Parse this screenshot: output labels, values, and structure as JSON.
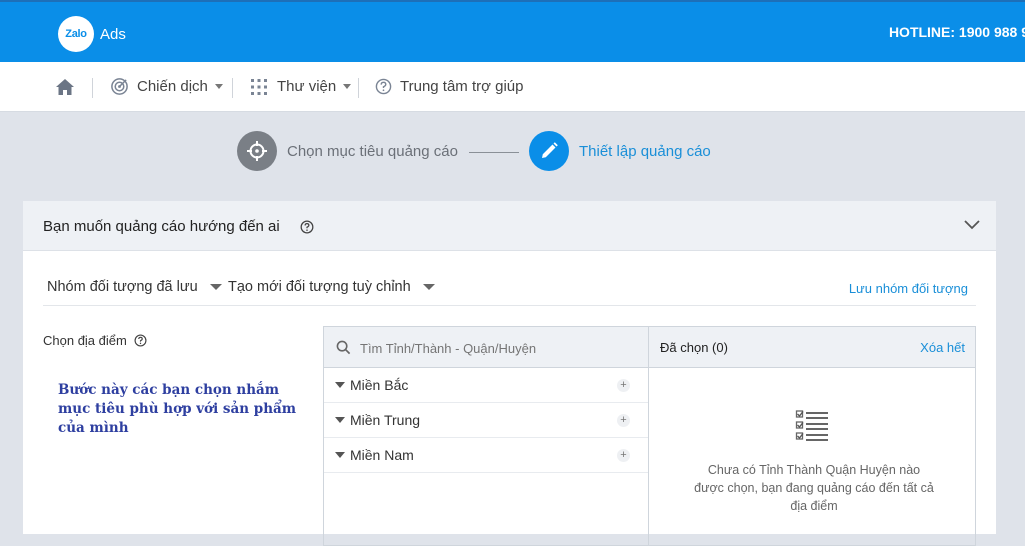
{
  "header": {
    "logo_text": "Zalo",
    "product": "Ads",
    "hotline": "HOTLINE: 1900 988 9"
  },
  "nav": {
    "items": [
      {
        "label": "Chiến dịch",
        "icon": "target-icon"
      },
      {
        "label": "Thư viện",
        "icon": "grid-icon"
      },
      {
        "label": "Trung tâm trợ giúp",
        "icon": "help-circle-icon"
      }
    ]
  },
  "stepper": {
    "step1": "Chọn mục tiêu quảng cáo",
    "step2": "Thiết lập quảng cáo"
  },
  "panel": {
    "title": "Bạn muốn quảng cáo hướng đến ai",
    "saved_groups": "Nhóm đối tượng đã lưu",
    "create_custom": "Tạo mới đối tượng tuỳ chỉnh",
    "save_group_link": "Lưu nhóm đối tượng",
    "location_label": "Chọn địa điểm",
    "search_placeholder": "Tìm Tỉnh/Thành - Quận/Huyện",
    "selected_label": "Đã chọn (0)",
    "clear_all": "Xóa hết",
    "regions": [
      "Miền Bắc",
      "Miền Trung",
      "Miền Nam"
    ],
    "empty_message": "Chưa có Tỉnh Thành Quận Huyện nào được chọn, bạn đang quảng cáo đến tất cả địa điểm"
  },
  "annotation": "Bước này các bạn chọn nhắm mục tiêu phù hợp với sản phẩm của mình",
  "colors": {
    "brand_blue": "#0a8ee8",
    "link_blue": "#1a8fd8",
    "annotation_blue": "#2e3fa0"
  }
}
